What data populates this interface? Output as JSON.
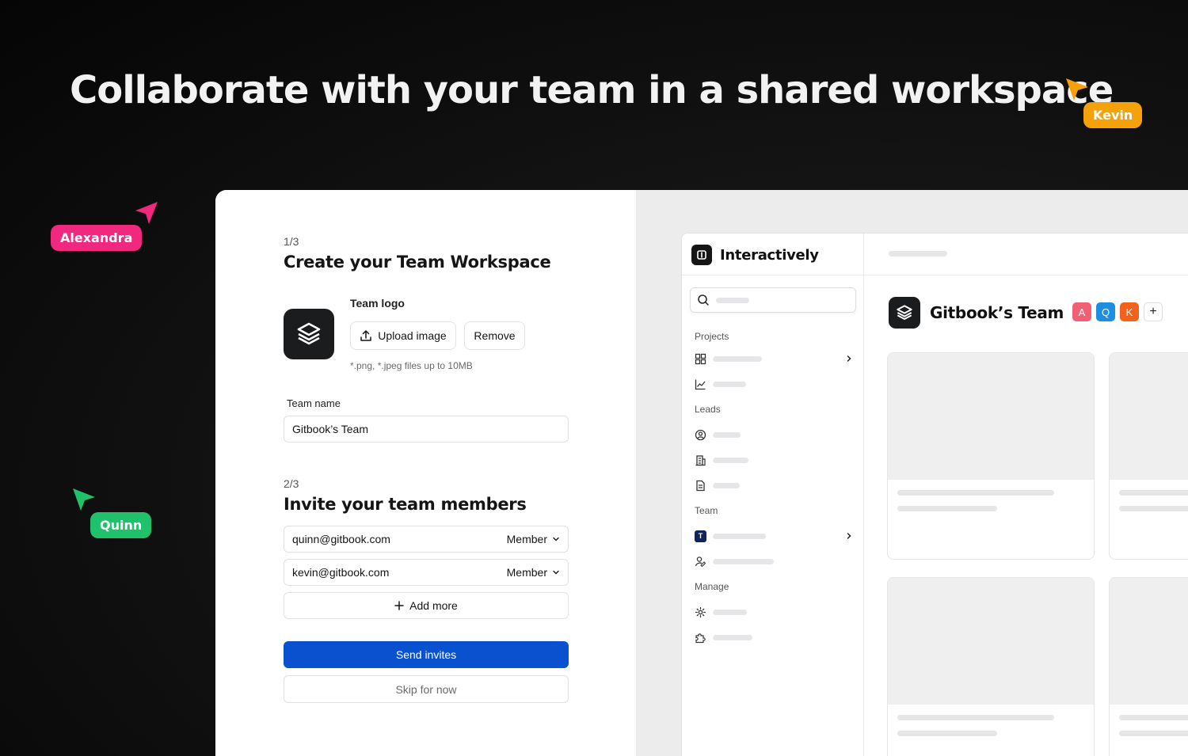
{
  "headline": "Collaborate with your team in a shared workspace",
  "collaborators": [
    {
      "name": "Kevin",
      "color": "#f5a10a"
    },
    {
      "name": "Alexandra",
      "color": "#f0287e"
    },
    {
      "name": "Quinn",
      "color": "#1fc16b"
    }
  ],
  "step1": {
    "counter": "1/3",
    "title": "Create your Team Workspace",
    "logo_label": "Team logo",
    "upload_label": "Upload image",
    "remove_label": "Remove",
    "file_hint": "*.png, *.jpeg files up to 10MB",
    "team_name_label": "Team name",
    "team_name_value": "Gitbook’s Team"
  },
  "step2": {
    "counter": "2/3",
    "title": "Invite your team members",
    "invites": [
      {
        "email": "quinn@gitbook.com",
        "role": "Member"
      },
      {
        "email": "kevin@gitbook.com",
        "role": "Member"
      }
    ],
    "add_more_label": "Add more",
    "send_label": "Send invites",
    "skip_label": "Skip for now"
  },
  "app": {
    "brand": "Interactively",
    "sections": {
      "projects": "Projects",
      "leads": "Leads",
      "team": "Team",
      "manage": "Manage"
    },
    "team_badge": "T",
    "team_title": "Gitbook’s Team",
    "avatars": [
      {
        "initial": "A",
        "color": "#f26076"
      },
      {
        "initial": "Q",
        "color": "#1d8fe0"
      },
      {
        "initial": "K",
        "color": "#f1621c"
      }
    ],
    "add_member": "+"
  },
  "colors": {
    "primary": "#0a51cf"
  }
}
